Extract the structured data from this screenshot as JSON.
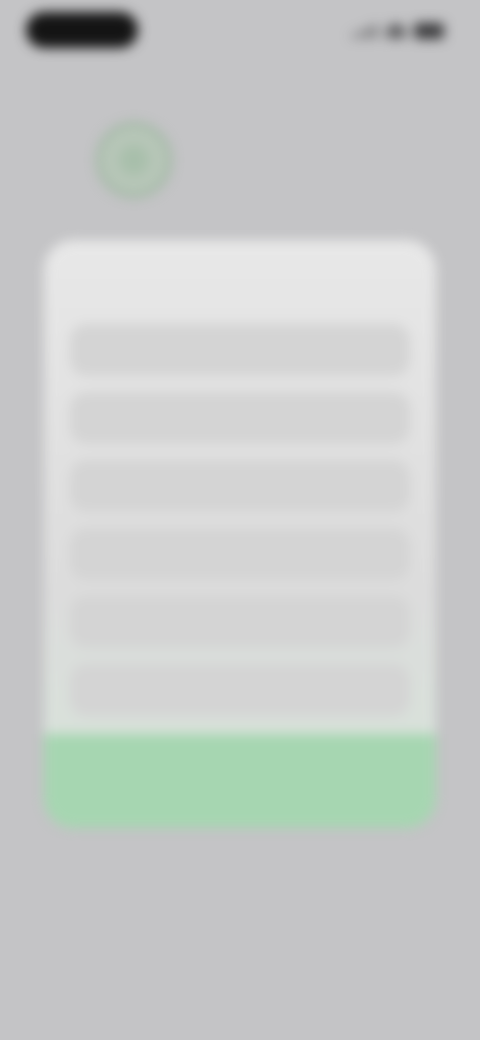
{
  "status_bar": {
    "time": "",
    "icons": [
      "signal-icon",
      "wifi-icon",
      "battery-icon"
    ]
  },
  "header": {
    "title": "",
    "subtitle": "",
    "logo_icon": "logo-icon"
  },
  "dialog": {
    "title": "",
    "options": [
      {
        "label": ""
      },
      {
        "label": ""
      },
      {
        "label": ""
      },
      {
        "label": ""
      },
      {
        "label": ""
      },
      {
        "label": ""
      }
    ],
    "confirm_label": ""
  },
  "footer": {
    "text": ""
  },
  "colors": {
    "background": "#c4c4c6",
    "dialog": "#e8e8e8",
    "option": "#d4d4d4",
    "accent": "#a6d6b1",
    "logo": "#9fb7a2"
  }
}
